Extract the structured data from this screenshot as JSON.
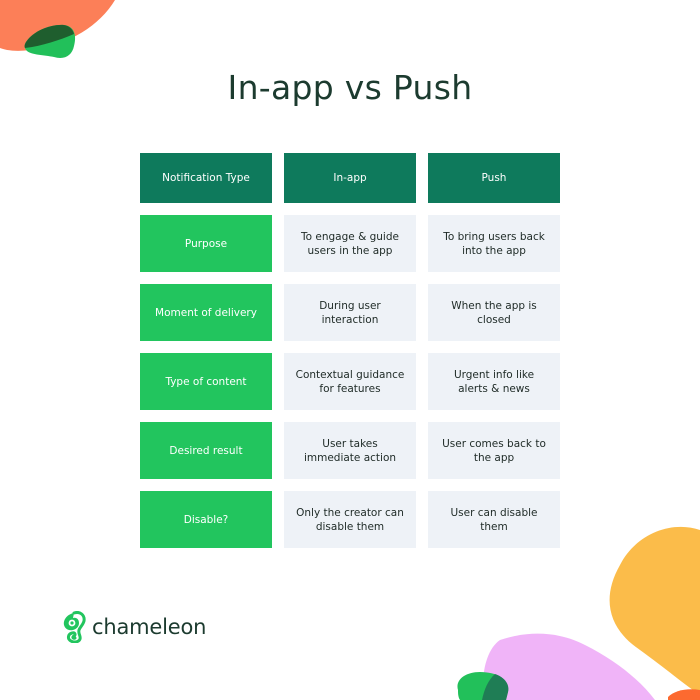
{
  "title": "In-app vs Push",
  "table": {
    "headers": [
      "Notification Type",
      "In-app",
      "Push"
    ],
    "rows": [
      {
        "label": "Purpose",
        "in_app": "To engage & guide users in the app",
        "push": "To bring users back into the app"
      },
      {
        "label": "Moment of delivery",
        "in_app": "During user interaction",
        "push": "When the app is closed"
      },
      {
        "label": "Type of content",
        "in_app": "Contextual guidance for features",
        "push": "Urgent info like alerts & news"
      },
      {
        "label": "Desired result",
        "in_app": "User takes immediate action",
        "push": "User comes back to the app"
      },
      {
        "label": "Disable?",
        "in_app": "Only the creator can disable them",
        "push": "User can disable them"
      }
    ]
  },
  "brand": {
    "name": "chameleon",
    "logo_icon": "chameleon-logo-icon"
  },
  "colors": {
    "header": "#0e7a5c",
    "row_label": "#22c55e",
    "cell_bg": "#eef2f7",
    "title": "#1c3b2f"
  }
}
